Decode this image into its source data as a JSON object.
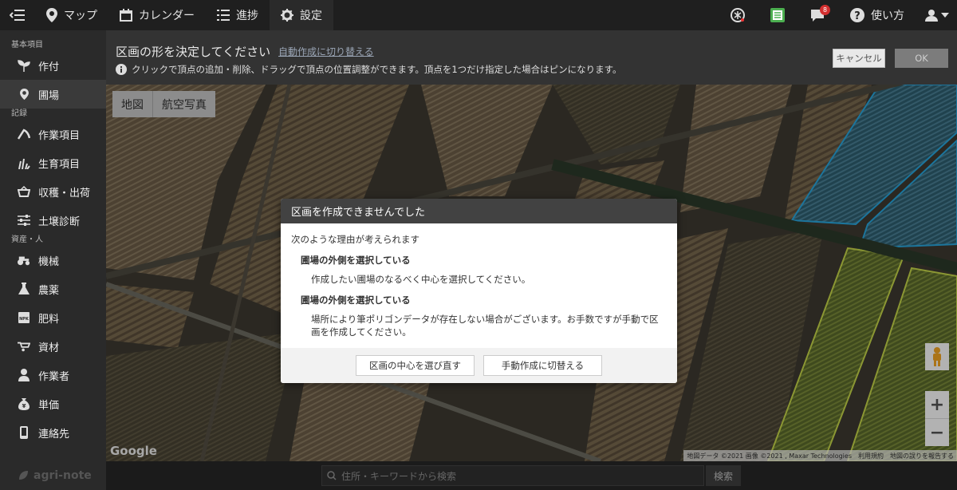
{
  "topbar": {
    "nav": [
      {
        "label": "マップ",
        "icon": "map-pin-icon"
      },
      {
        "label": "カレンダー",
        "icon": "calendar-icon"
      },
      {
        "label": "進捗",
        "icon": "list-icon"
      },
      {
        "label": "設定",
        "icon": "gear-icon"
      }
    ],
    "notification_count": "8",
    "help_label": "使い方"
  },
  "sidebar": {
    "section_basic": "基本項目",
    "section_record": "記録",
    "section_assets": "資産・人",
    "items": [
      {
        "label": "作付"
      },
      {
        "label": "圃場"
      },
      {
        "label": "作業項目"
      },
      {
        "label": "生育項目"
      },
      {
        "label": "収穫・出荷"
      },
      {
        "label": "土壌診断"
      },
      {
        "label": "機械"
      },
      {
        "label": "農薬"
      },
      {
        "label": "肥料"
      },
      {
        "label": "資材"
      },
      {
        "label": "作業者"
      },
      {
        "label": "単価"
      },
      {
        "label": "連絡先"
      }
    ],
    "brand": "agri-note"
  },
  "header": {
    "title": "区画の形を決定してください",
    "switch_link": "自動作成に切り替える",
    "hint": "クリックで頂点の追加・削除、ドラッグで頂点の位置調整ができます。頂点を1つだけ指定した場合はピンになります。",
    "cancel_label": "キャンセル",
    "ok_label": "OK"
  },
  "map": {
    "type_map": "地図",
    "type_satellite": "航空写真",
    "google": "Google",
    "attribution": [
      "地図データ ©2021 画像 ©2021 , Maxar Technologies",
      "利用規約",
      "地図の誤りを報告する"
    ],
    "zoom_in": "+",
    "zoom_out": "−"
  },
  "search": {
    "placeholder": "住所・キーワードから検索",
    "button": "検索"
  },
  "dialog": {
    "title": "区画を作成できませんでした",
    "intro": "次のような理由が考えられます",
    "reasons": [
      {
        "title": "圃場の外側を選択している",
        "desc": "作成したい圃場のなるべく中心を選択してください。"
      },
      {
        "title": "圃場の外側を選択している",
        "desc": "場所により筆ポリゴンデータが存在しない場合がございます。お手数ですが手動で区画を作成してください。"
      }
    ],
    "reselect_label": "区画の中心を選び直す",
    "manual_label": "手動作成に切替える"
  }
}
